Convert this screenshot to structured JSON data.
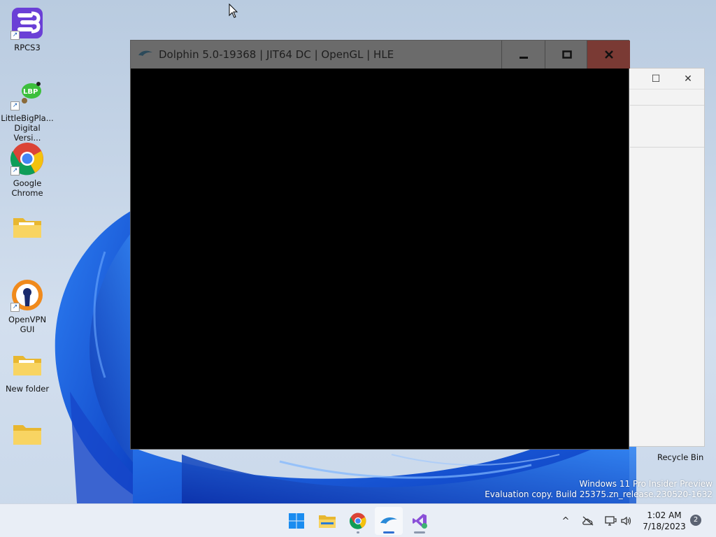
{
  "desktop": {
    "icons": [
      {
        "label": "RPCS3",
        "icon": "rpcs3-icon",
        "shortcut": true
      },
      {
        "label": "LittleBigPla... Digital Versi...",
        "icon": "littlebigplanet-icon",
        "shortcut": true
      },
      {
        "label": "Google Chrome",
        "icon": "chrome-icon",
        "shortcut": true
      },
      {
        "label": "",
        "icon": "folder-icon",
        "shortcut": false
      },
      {
        "label": "OpenVPN GUI",
        "icon": "openvpn-icon",
        "shortcut": true
      },
      {
        "label": "New folder",
        "icon": "folder-icon",
        "shortcut": false
      },
      {
        "label": "",
        "icon": "folder-icon",
        "shortcut": false
      }
    ],
    "recycle_bin_label": "Recycle Bin",
    "watermark_line1": "Windows 11 Pro Insider Preview",
    "watermark_line2": "Evaluation copy. Build 25375.zn_release.230520-1632"
  },
  "dolphin_window": {
    "title": "Dolphin 5.0-19368 | JIT64 DC | OpenGL | HLE",
    "minimize": "minimize",
    "maximize": "maximize",
    "close": "close"
  },
  "background_window": {
    "maximize_glyph": "☐",
    "close_glyph": "✕"
  },
  "taskbar": {
    "apps": [
      {
        "icon": "start-icon",
        "active": false
      },
      {
        "icon": "file-explorer-icon",
        "active": false
      },
      {
        "icon": "chrome-icon",
        "active": false
      },
      {
        "icon": "dolphin-icon",
        "active": true
      },
      {
        "icon": "visual-studio-icon",
        "active": false
      }
    ],
    "tray": {
      "chevron": "^",
      "time": "1:02 AM",
      "date": "7/18/2023",
      "notification_count": "2"
    }
  },
  "colors": {
    "dolphin_titlebar": "#6b6b6b",
    "close_button": "#7a3a34",
    "taskbar_bg": "#e9eef6",
    "wallpaper_accent": "#1a5fd6"
  }
}
